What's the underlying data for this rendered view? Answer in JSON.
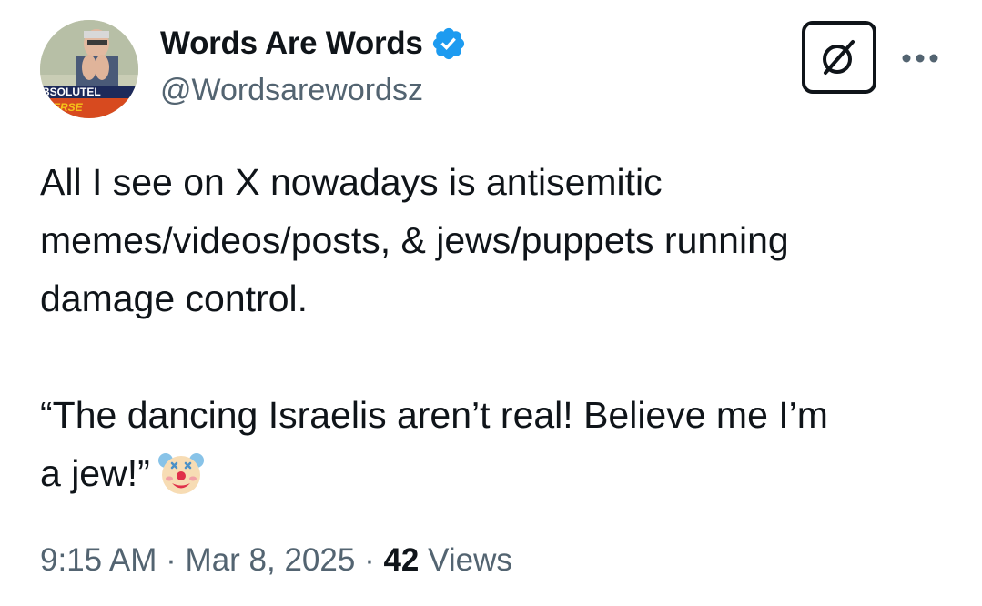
{
  "author": {
    "display_name": "Words Are Words",
    "handle": "@Wordsarewordsz",
    "verified": true,
    "avatar_caption": "BSOLUTELY VERSE"
  },
  "tweet": {
    "paragraph_1": "All I see on X nowadays is antisemitic\nmemes/videos/posts, & jews/puppets running\ndamage control.",
    "paragraph_2": "“The dancing Israelis aren’t real! Believe me I’m\na jew!”",
    "emoji": "clown-face"
  },
  "meta": {
    "time": "9:15 AM",
    "separator": "·",
    "date": "Mar 8, 2025",
    "views_count": "42",
    "views_label": "Views"
  },
  "colors": {
    "text_primary": "#0f1419",
    "text_secondary": "#536471",
    "verified_blue": "#1d9bf0"
  },
  "icons": {
    "grok": "grok-icon",
    "more": "more-icon",
    "verified": "verified-badge-icon"
  }
}
